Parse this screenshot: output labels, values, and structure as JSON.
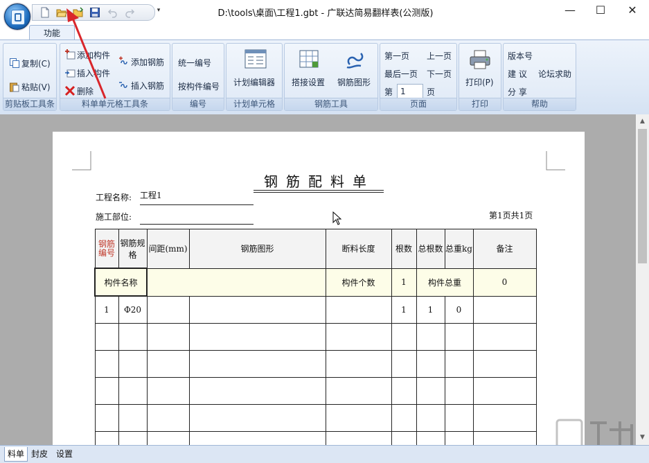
{
  "window": {
    "title": "D:\\tools\\桌面\\工程1.gbt - 广联达简易翻样表(公测版)",
    "minimize": "—",
    "maximize": "☐",
    "close": "✕",
    "qat_more": "▾"
  },
  "ribbon": {
    "tab": "功能",
    "groups": {
      "clipboard": {
        "label": "剪贴板工具条",
        "copy": "复制(C)",
        "paste": "粘贴(V)"
      },
      "cell_tools": {
        "label": "料单单元格工具条",
        "add_component": "添加构件",
        "insert_component": "插入构件",
        "delete": "删除",
        "add_rebar": "添加钢筋",
        "insert_rebar": "插入钢筋"
      },
      "numbering": {
        "label": "编号",
        "unify": "统一编号",
        "by_component": "按构件编号"
      },
      "plan": {
        "label": "计划单元格",
        "editor": "计划编辑器"
      },
      "rebar_tools": {
        "label": "钢筋工具",
        "lap": "搭接设置",
        "shape": "钢筋图形"
      },
      "page": {
        "label": "页面",
        "first": "第一页",
        "prev": "上一页",
        "last": "最后一页",
        "next": "下一页",
        "go_prefix": "第",
        "go_value": "1",
        "go_suffix": "页"
      },
      "print": {
        "label": "打印",
        "print": "打印(P)"
      },
      "help": {
        "label": "帮助",
        "version": "版本号",
        "suggest": "建 议",
        "forum": "论坛求助",
        "share": "分 享"
      }
    }
  },
  "sheet": {
    "title": "钢筋配料单",
    "project_label": "工程名称:",
    "project_value": "工程1",
    "site_label": "施工部位:",
    "site_value": "",
    "page_info": "第1页共1页",
    "headers": [
      "钢筋编号",
      "钢筋规格",
      "间距(mm)",
      "钢筋图形",
      "断料长度",
      "根数",
      "总根数",
      "总重kg",
      "备注"
    ],
    "component_row": {
      "name_label": "构件名称",
      "count_label": "构件个数",
      "count_value": "1",
      "weight_label": "构件总重",
      "weight_value": "0"
    },
    "rows": [
      [
        "1",
        "Φ20",
        "",
        "",
        "",
        "1",
        "1",
        "0",
        ""
      ],
      [
        "",
        "",
        "",
        "",
        "",
        "",
        "",
        "",
        ""
      ],
      [
        "",
        "",
        "",
        "",
        "",
        "",
        "",
        "",
        ""
      ],
      [
        "",
        "",
        "",
        "",
        "",
        "",
        "",
        "",
        ""
      ],
      [
        "",
        "",
        "",
        "",
        "",
        "",
        "",
        "",
        ""
      ],
      [
        "",
        "",
        "",
        "",
        "",
        "",
        "",
        "",
        ""
      ]
    ]
  },
  "sheet_tabs": [
    "料单",
    "封皮",
    "设置"
  ],
  "colors": {
    "annotation_arrow": "#d9262b",
    "ribbon": "#dde8f6",
    "workspace": "#acacac"
  }
}
